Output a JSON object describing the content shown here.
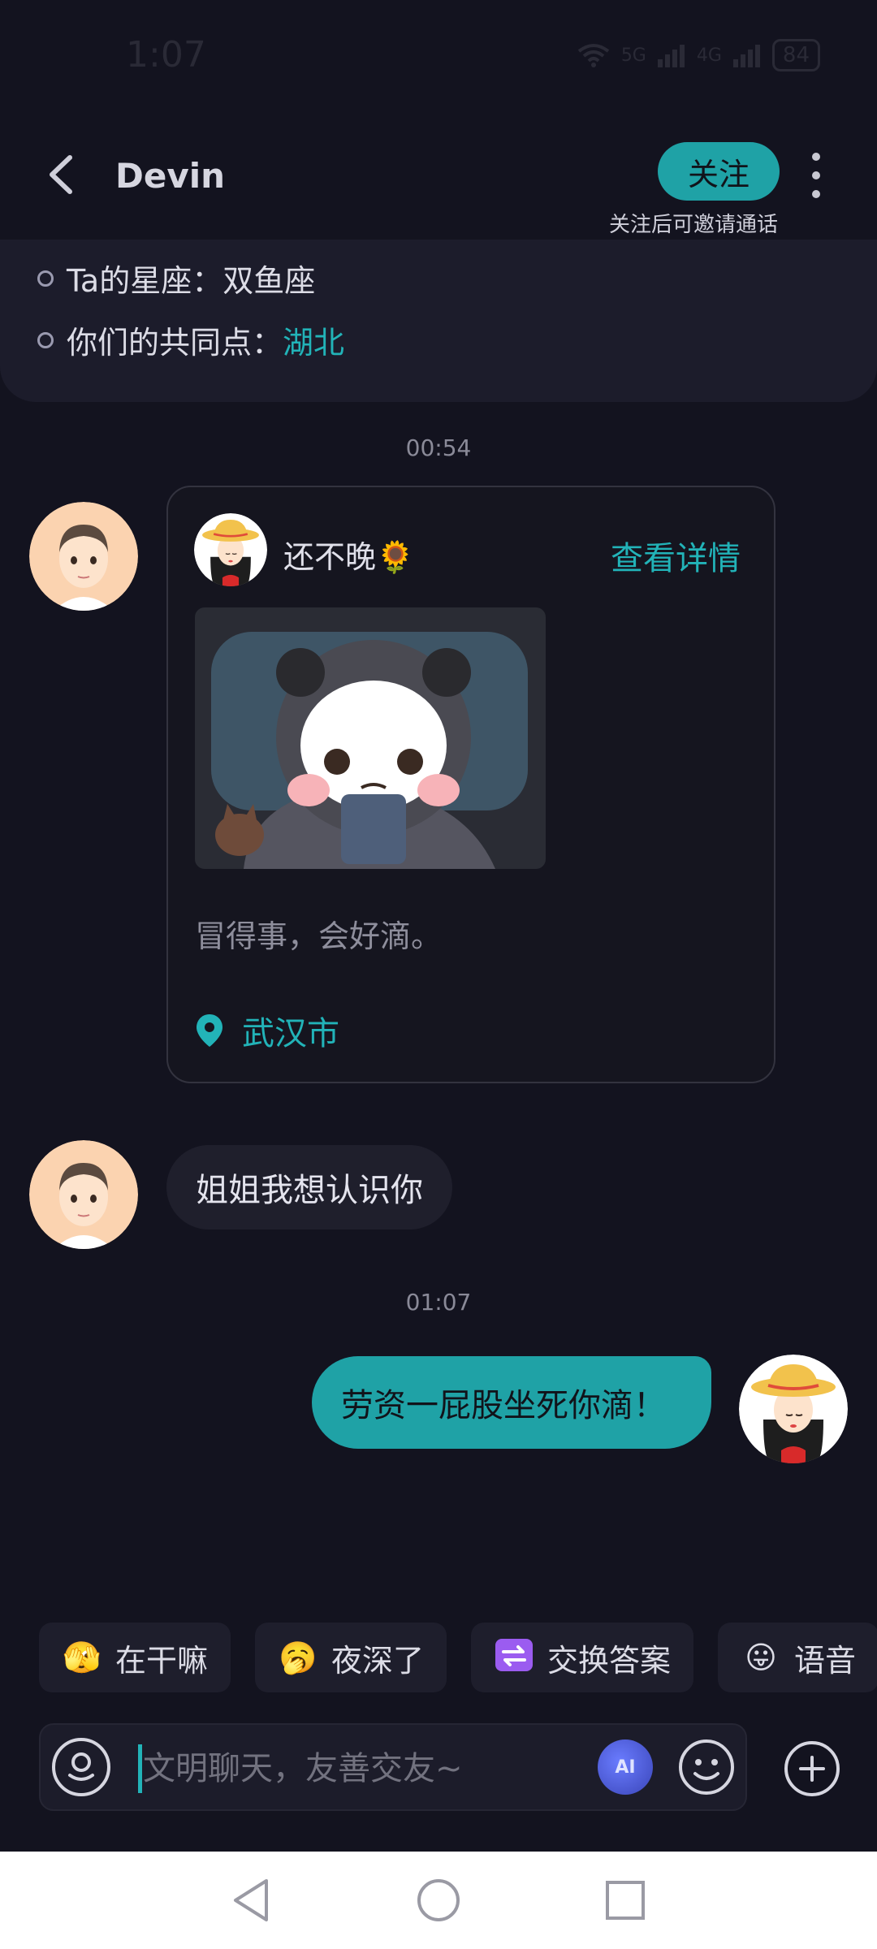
{
  "status_bar": {
    "time": "1:07",
    "network_1": "5G",
    "network_2": "4G",
    "battery": "84"
  },
  "header": {
    "title": "Devin",
    "follow_label": "关注",
    "follow_hint": "关注后可邀请通话"
  },
  "profile_info": {
    "zodiac_label": "Ta的星座：",
    "zodiac_value": "双鱼座",
    "common_label": "你们的共同点：",
    "common_value": "湖北"
  },
  "messages": {
    "time_1": "00:54",
    "post": {
      "author": "还不晚🌻",
      "detail_link": "查看详情",
      "text": "冒得事，会好滴。",
      "location": "武汉市"
    },
    "incoming_text": "姐姐我想认识你",
    "time_2": "01:07",
    "outgoing_text": "劳资一屁股坐死你滴！"
  },
  "quick_replies": [
    {
      "icon": "🫣",
      "label": "在干嘛"
    },
    {
      "icon": "🥱",
      "label": "夜深了"
    },
    {
      "icon": "⇄",
      "label": "交换答案"
    },
    {
      "icon": "😛",
      "label": "语音"
    }
  ],
  "input": {
    "placeholder": "文明聊天，友善交友~",
    "ai_label": "AI"
  },
  "colors": {
    "accent": "#1fa2a6",
    "background": "#13131f"
  }
}
